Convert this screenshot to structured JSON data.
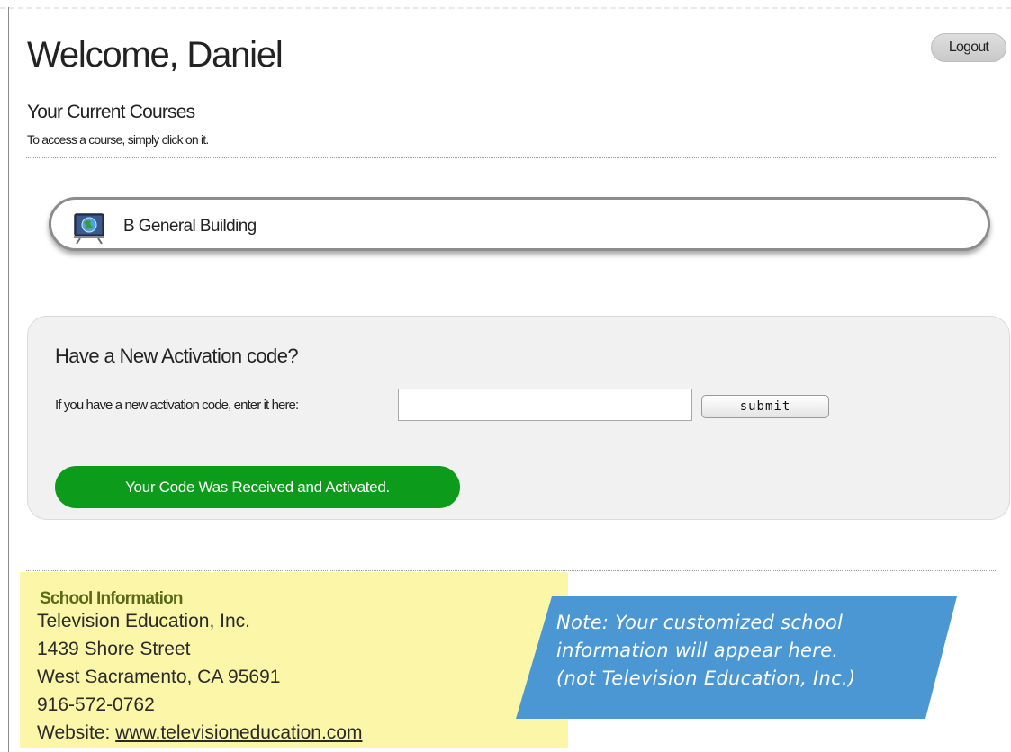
{
  "header": {
    "welcome": "Welcome, Daniel",
    "logout_label": "Logout"
  },
  "courses": {
    "title": "Your Current Courses",
    "hint": "To access a course, simply click on it.",
    "items": [
      {
        "label": "B General Building",
        "icon": "presentation-globe-icon"
      }
    ]
  },
  "activation": {
    "title": "Have a New Activation code?",
    "prompt": "If you have a new activation code, enter it here:",
    "input_value": "",
    "submit_label": "submit",
    "status_message": "Your Code Was Received and Activated.",
    "status_color": "#0d9b1c"
  },
  "school_info": {
    "heading": "School Information",
    "name": "Television Education, Inc.",
    "street": "1439 Shore Street",
    "city": "West Sacramento, CA 95691",
    "phone": "916-572-0762",
    "website_label": "Website:",
    "website_url": "www.televisioneducation.com",
    "background_color": "#fbf6a8"
  },
  "note": {
    "lines": [
      "Note: Your customized school",
      "information will appear here.",
      "(not Television Education, Inc.)"
    ],
    "background_color": "#4a97d3"
  }
}
